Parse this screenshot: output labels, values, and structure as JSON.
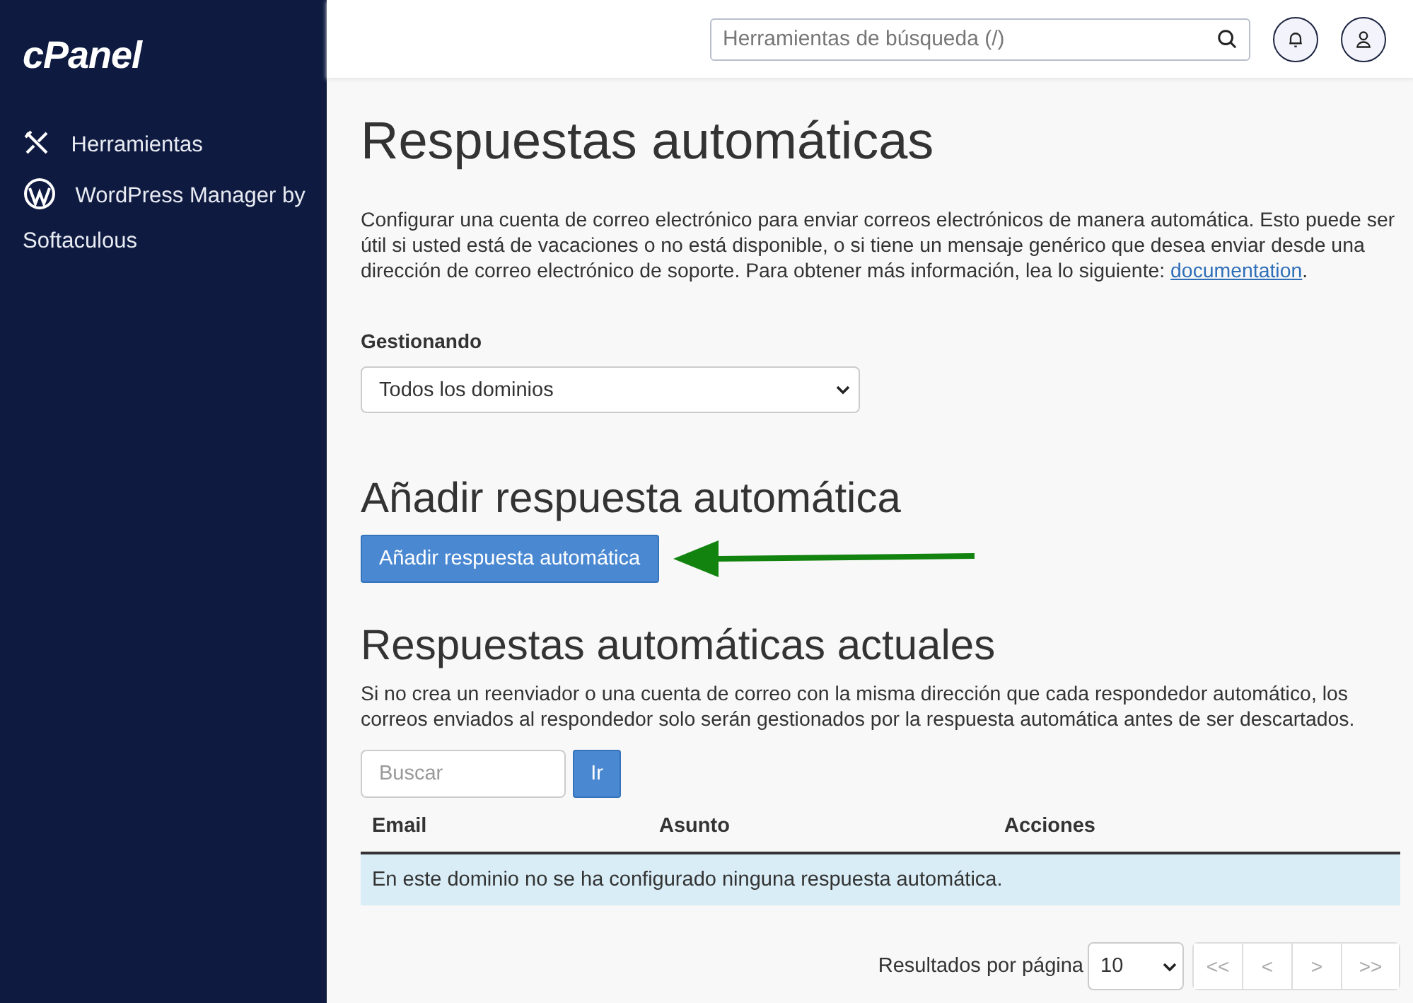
{
  "sidebar": {
    "logo": "cPanel",
    "items": [
      {
        "kind": "tools",
        "label": "Herramientas"
      },
      {
        "kind": "wordpress",
        "label": "WordPress Manager by Softaculous"
      }
    ]
  },
  "header": {
    "search": {
      "placeholder": "Herramientas de búsqueda (/)"
    }
  },
  "page": {
    "title": "Respuestas automáticas",
    "intro": "Configurar una cuenta de correo electrónico para enviar correos electrónicos de manera automática. Esto puede ser útil si usted está de vacaciones o no está disponible, o si tiene un mensaje genérico que desea enviar desde una dirección de correo electrónico de soporte. Para obtener más información, lea lo siguiente:",
    "intro_link": "documentation",
    "intro_end": ".",
    "managing": {
      "label": "Gestionando",
      "value": "Todos los dominios"
    },
    "add_section": {
      "title": "Añadir respuesta automática",
      "button": "Añadir respuesta automática"
    },
    "current_section": {
      "title": "Respuestas automáticas actuales",
      "note": "Si no crea un reenviador o una cuenta de correo con la misma dirección que cada respondedor automático, los correos enviados al respondedor solo serán gestionados por la respuesta automática antes de ser descartados.",
      "search": {
        "placeholder": "Buscar",
        "button": "Ir"
      },
      "table": {
        "columns": [
          "Email",
          "Asunto",
          "Acciones"
        ],
        "empty_message": "En este dominio no se ha configurado ninguna respuesta automática."
      },
      "pagination": {
        "label": "Resultados por página",
        "per_page": "10",
        "buttons": [
          {
            "label": "<<",
            "disabled": true
          },
          {
            "label": "<",
            "disabled": true
          },
          {
            "label": ">",
            "disabled": true
          },
          {
            "label": ">>",
            "disabled": true
          }
        ]
      }
    }
  }
}
